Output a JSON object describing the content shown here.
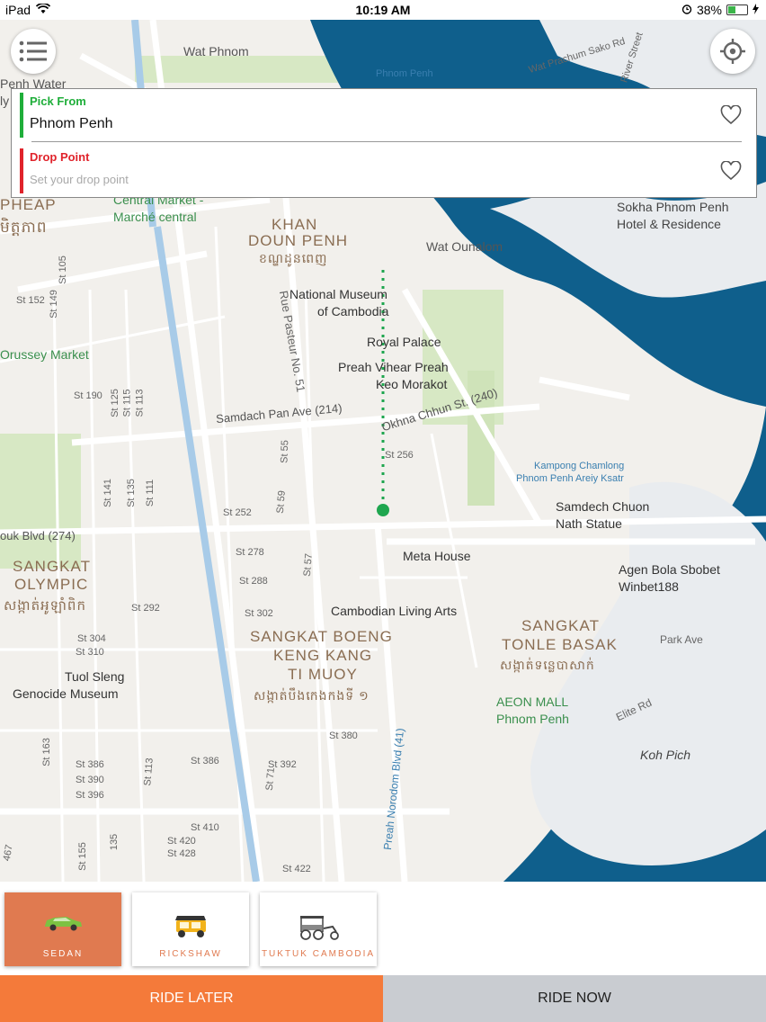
{
  "status_bar": {
    "device": "iPad",
    "time": "10:19 AM",
    "battery": "38%",
    "battery_fraction": 0.38
  },
  "map": {
    "labels": {
      "wat_phnom": "Wat Phnom",
      "phnom_penh_poi": "Phnom Penh",
      "wat_prachum": "Wat Prachum Sako Rd",
      "river_street": "River Street",
      "penh_water": "Penh Water",
      "ly": "ly",
      "central_market": "Central Market -",
      "marche_central": "Marché central",
      "pheap": "PHEAP",
      "khmer_pheap": "មិត្តភាព",
      "khan": "KHAN",
      "doun_penh": "DOUN PENH",
      "khmer_doun_penh": "ខណ្ឌដូនពេញ",
      "wat_ounalom": "Wat Ounalom",
      "sokha": "Sokha Phnom Penh",
      "sokha2": "Hotel & Residence",
      "national_museum": "National Museum",
      "of_cambodia": "of Cambodia",
      "royal_palace": "Royal Palace",
      "preah_vihear": "Preah Vihear Preah",
      "keo_morakot": "Keo Morakot",
      "rue_pasteur": "Rue Pasteur No. 51",
      "orussey": "Orussey Market",
      "samdach": "Samdach Pan Ave (214)",
      "okhna": "Okhna Chhun St. (240)",
      "kampong": "Kampong Chamlong",
      "kampong2": "Phnom Penh Areiy Ksatr",
      "samdech_chuon": "Samdech Chuon",
      "nath_statue": "Nath Statue",
      "ouk_blvd": "ouk Blvd (274)",
      "meta_house": "Meta House",
      "agen": "Agen Bola Sbobet",
      "winbet": "Winbet188",
      "sangkat_olympic": "SANGKAT",
      "olympic": "OLYMPIC",
      "khmer_olympic": "សង្កាត់អូឡាំពិក",
      "cambodian_living": "Cambodian Living Arts",
      "sangkat_tonle": "SANGKAT",
      "tonle_basak": "TONLE BASAK",
      "khmer_tonle": "សង្កាត់ទន្លេបាសាក់",
      "boeng1": "SANGKAT BOENG",
      "boeng2": "KENG KANG",
      "boeng3": "TI MUOY",
      "khmer_boeng": "សង្កាត់បឹងកេងកងទី ១",
      "park_ave": "Park Ave",
      "tuol_sleng": "Tuol Sleng",
      "genocide": "Genocide Museum",
      "aeon": "AEON MALL",
      "aeon2": "Phnom Penh",
      "elite_rd": "Elite Rd",
      "koh_pich": "Koh Pich",
      "norodom": "Preah Norodom Blvd (41)",
      "st_190": "St 190",
      "st_152": "St 152",
      "st_149": "St 149",
      "st_105": "St 105",
      "st_125": "St 125",
      "st_115": "St 115",
      "st_113": "St 113",
      "st_141": "St 141",
      "st_135": "St 135",
      "st_111": "St 111",
      "st_55": "St 55",
      "st_59": "St 59",
      "st_252": "St 252",
      "st_256": "St 256",
      "st_278": "St 278",
      "st_57": "St 57",
      "st_288": "St 288",
      "st_292": "St 292",
      "st_302": "St 302",
      "st_304": "St 304",
      "st_310": "St 310",
      "st_163": "St 163",
      "st_386a": "St 386",
      "st_390": "St 390",
      "st_396": "St 396",
      "st_386b": "St 386",
      "st_392": "St 392",
      "st_380": "St 380",
      "st_410": "St 410",
      "st_420": "St 420",
      "st_428": "St 428",
      "st_422": "St 422",
      "st_155": "St 155",
      "st_71": "St 71",
      "st_467": "467",
      "st_135b": "135"
    }
  },
  "controls": {
    "menu_icon": "menu-icon",
    "locate_icon": "locate-icon"
  },
  "pickup": {
    "title": "Pick From",
    "value": "Phnom Penh",
    "accent": "#1fae3a"
  },
  "dropoff": {
    "title": "Drop Point",
    "placeholder": "Set your drop point",
    "accent": "#e0232b"
  },
  "vehicles": [
    {
      "label": "SEDAN",
      "icon": "car-icon",
      "selected": true
    },
    {
      "label": "RICKSHAW",
      "icon": "rickshaw-icon",
      "selected": false
    },
    {
      "label": "TUKTUK CAMBODIA",
      "icon": "tuktuk-icon",
      "selected": false
    }
  ],
  "actions": {
    "ride_later": "RIDE LATER",
    "ride_now": "RIDE NOW"
  },
  "colors": {
    "accent_orange": "#f47a3a",
    "ride_now_bg": "#c9ccd1",
    "river": "#0f5f8c",
    "park": "#cfe3b9"
  }
}
